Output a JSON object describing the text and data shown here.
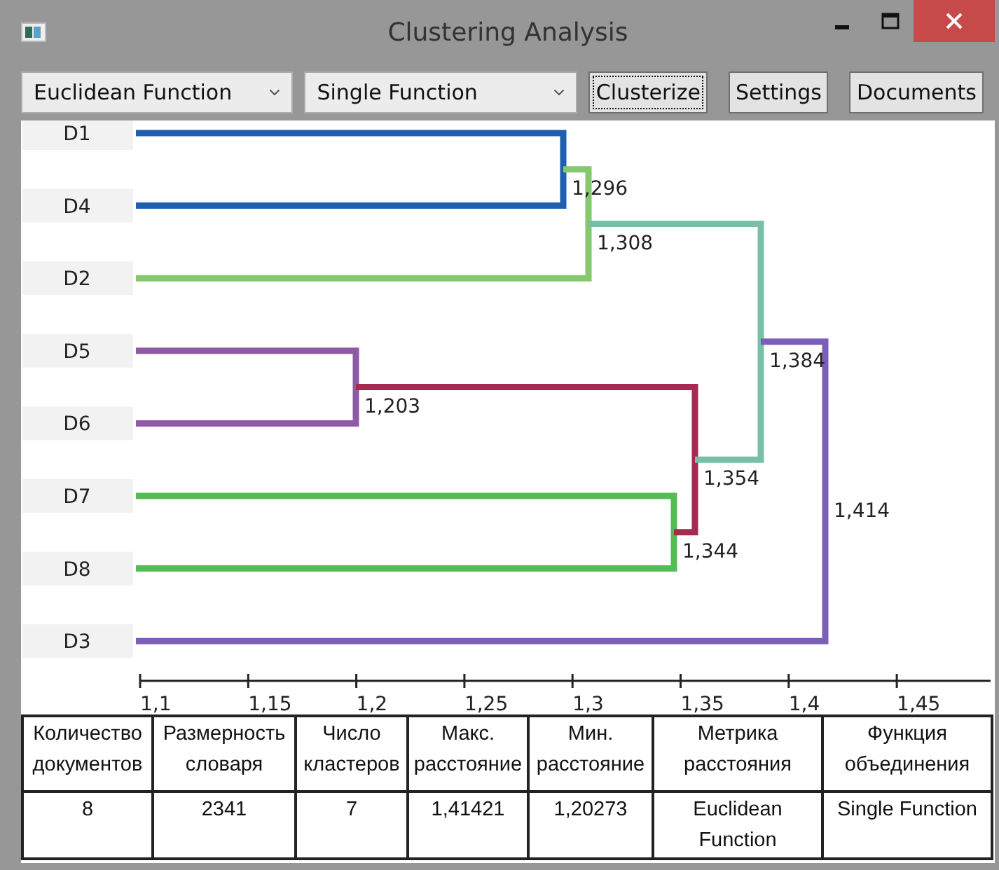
{
  "window": {
    "title": "Clustering Analysis"
  },
  "toolbar": {
    "dropdowns": [
      {
        "value": "Euclidean Function"
      },
      {
        "value": "Single Function"
      }
    ],
    "buttons": [
      {
        "label": "Clusterize",
        "focused": true
      },
      {
        "label": "Settings",
        "focused": false
      },
      {
        "label": "Documents",
        "focused": false
      }
    ]
  },
  "dendrogram": {
    "tree": {
      "label": "1,414",
      "color": "#7a5fb8",
      "children": [
        {
          "label": "1,384",
          "color": "#78bfa8",
          "children": [
            {
              "label": "1,308",
              "color": "#86c86e",
              "children": [
                {
                  "label": "1,296",
                  "color": "#1f5fb0",
                  "children": [
                    {
                      "name": "D1"
                    },
                    {
                      "name": "D4"
                    }
                  ]
                },
                {
                  "name": "D2"
                }
              ]
            },
            {
              "label": "1,354",
              "color": "#a82a52",
              "children": [
                {
                  "label": "1,203",
                  "color": "#8e5aa6",
                  "children": [
                    {
                      "name": "D5"
                    },
                    {
                      "name": "D6"
                    }
                  ]
                },
                {
                  "label": "1,344",
                  "color": "#55bb55",
                  "children": [
                    {
                      "name": "D7"
                    },
                    {
                      "name": "D8"
                    }
                  ]
                }
              ]
            }
          ]
        },
        {
          "name": "D3"
        }
      ]
    },
    "axis_ticks": [
      "1,1",
      "1,15",
      "1,2",
      "1,25",
      "1,3",
      "1,35",
      "1,4",
      "1,45"
    ]
  },
  "summary_table": {
    "columns": [
      "Количество документов",
      "Размерность словаря",
      "Число кластеров",
      "Макс. расстояние",
      "Мин. расстояние",
      "Метрика расстояния",
      "Функция объединения"
    ],
    "rows": [
      [
        "8",
        "2341",
        "7",
        "1,41421",
        "1,20273",
        "Euclidean Function",
        "Single Function"
      ]
    ]
  }
}
